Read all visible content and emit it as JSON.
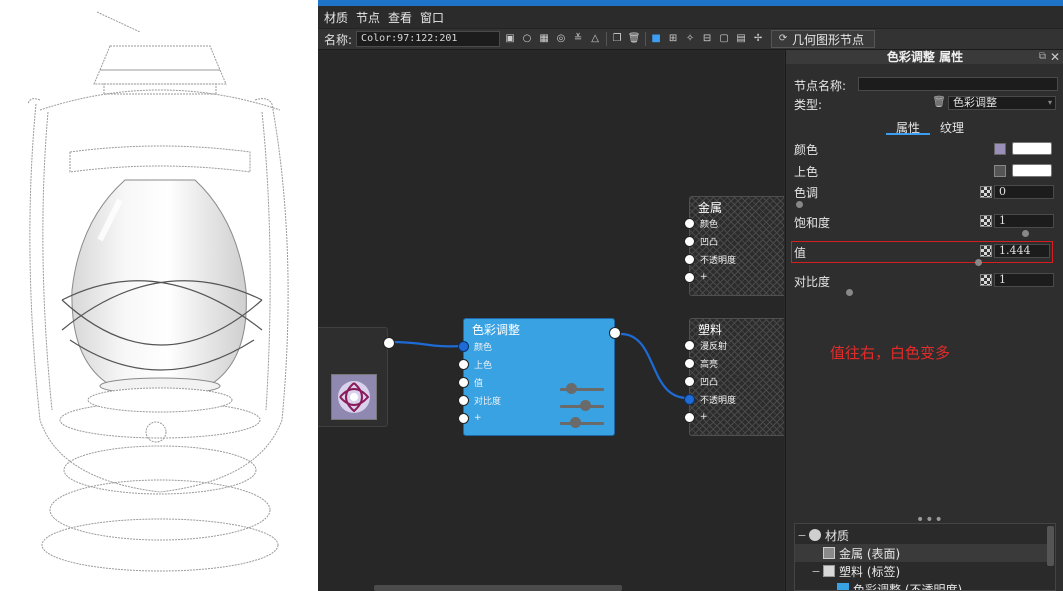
{
  "menubar": {
    "items": [
      "材质",
      "节点",
      "查看",
      "窗口"
    ]
  },
  "toolbar": {
    "name_label": "名称:",
    "name_value": "Color:97:122:201",
    "geometry_button_label": "几何图形节点"
  },
  "nodes": {
    "metal": {
      "title": "金属",
      "pins": [
        "颜色",
        "凹凸",
        "不透明度",
        "+"
      ]
    },
    "plastic": {
      "title": "塑料",
      "pins": [
        "漫反射",
        "高亮",
        "凹凸",
        "不透明度",
        "+"
      ]
    },
    "color_adjust": {
      "title": "色彩调整",
      "pins": [
        "颜色",
        "上色",
        "值",
        "对比度",
        "+"
      ]
    }
  },
  "panel": {
    "title": "色彩调整 属性",
    "node_name_label": "节点名称:",
    "node_name_value": "",
    "type_label": "类型:",
    "type_value": "色彩调整",
    "tabs": [
      "属性",
      "纹理"
    ],
    "active_tab": "属性",
    "props": {
      "color": {
        "label": "颜色"
      },
      "tint": {
        "label": "上色"
      },
      "hue": {
        "label": "色调",
        "value": "0"
      },
      "saturation": {
        "label": "饱和度",
        "value": "1"
      },
      "brightness": {
        "label": "值",
        "value": "1.444"
      },
      "contrast": {
        "label": "对比度",
        "value": "1"
      }
    },
    "annotation": "值往右，白色变多",
    "tree": {
      "items": [
        {
          "label": "材质",
          "expander": "−"
        },
        {
          "label": "金属 (表面)",
          "expander": ""
        },
        {
          "label": "塑料 (标签)",
          "expander": "−"
        },
        {
          "label": "色彩调整 (不透明度)",
          "expander": ""
        }
      ]
    }
  },
  "colors": {
    "accent": "#3c9ef2",
    "node_blue": "#38a2e3",
    "wire_blue": "#1e6bd6",
    "highlight_red": "#d61e1e",
    "annotation_red": "#e62a2a"
  }
}
